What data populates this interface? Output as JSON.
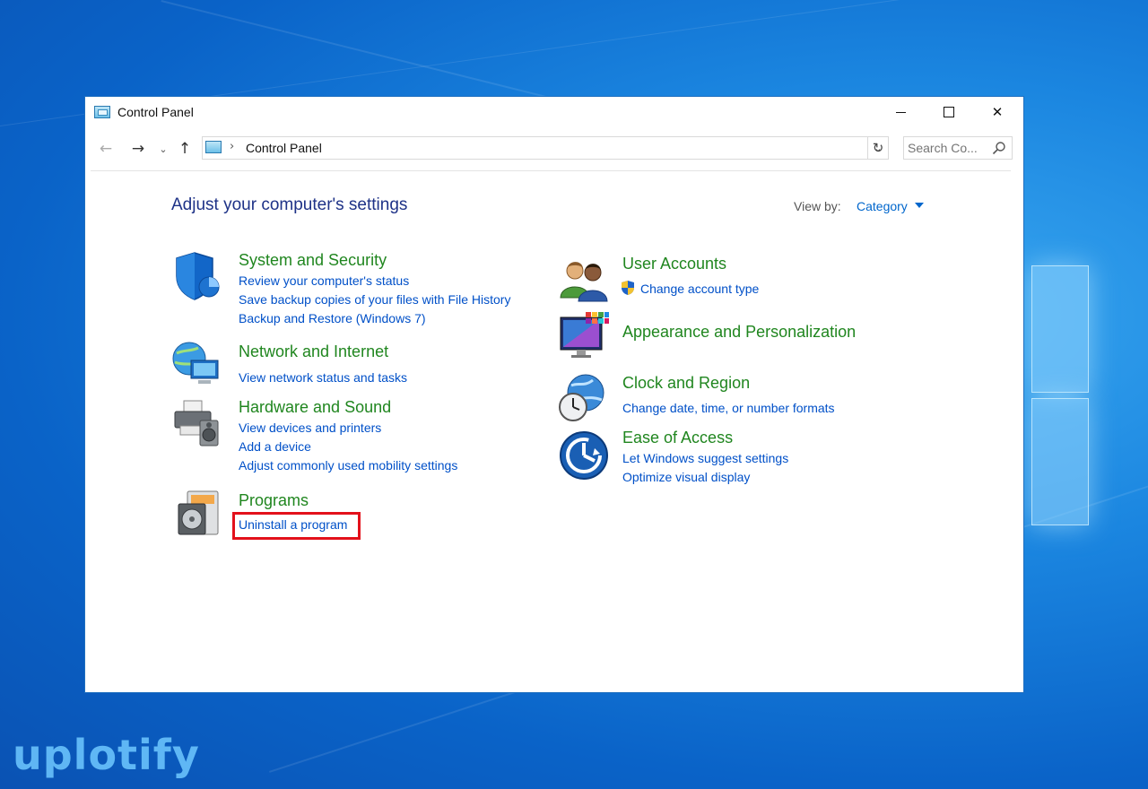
{
  "window": {
    "title": "Control Panel",
    "controls": {
      "minimize": "",
      "maximize": "",
      "close": "✕"
    }
  },
  "navbar": {
    "back": "←",
    "forward": "→",
    "recent": "⌄",
    "up": "↑",
    "breadcrumb_sep": "›",
    "address": "Control Panel",
    "dropdown": "⌄",
    "refresh": "↻",
    "search_placeholder": "Search Co..."
  },
  "main": {
    "heading": "Adjust your computer's settings",
    "view_by_label": "View by:",
    "view_by_value": "Category"
  },
  "left": [
    {
      "title": "System and Security",
      "links": [
        "Review your computer's status",
        "Save backup copies of your files with File History",
        "Backup and Restore (Windows 7)"
      ]
    },
    {
      "title": "Network and Internet",
      "links": [
        "View network status and tasks"
      ]
    },
    {
      "title": "Hardware and Sound",
      "links": [
        "View devices and printers",
        "Add a device",
        "Adjust commonly used mobility settings"
      ]
    },
    {
      "title": "Programs",
      "links": [
        "Uninstall a program"
      ]
    }
  ],
  "right": [
    {
      "title": "User Accounts",
      "links": [
        "Change account type"
      ]
    },
    {
      "title": "Appearance and Personalization",
      "links": []
    },
    {
      "title": "Clock and Region",
      "links": [
        "Change date, time, or number formats"
      ]
    },
    {
      "title": "Ease of Access",
      "links": [
        "Let Windows suggest settings",
        "Optimize visual display"
      ]
    }
  ],
  "watermark": "uplotify",
  "colors": {
    "accent_link": "#0050c8",
    "category_green": "#20861f",
    "heading_blue": "#1e3287",
    "highlight_red": "#e3111b"
  }
}
